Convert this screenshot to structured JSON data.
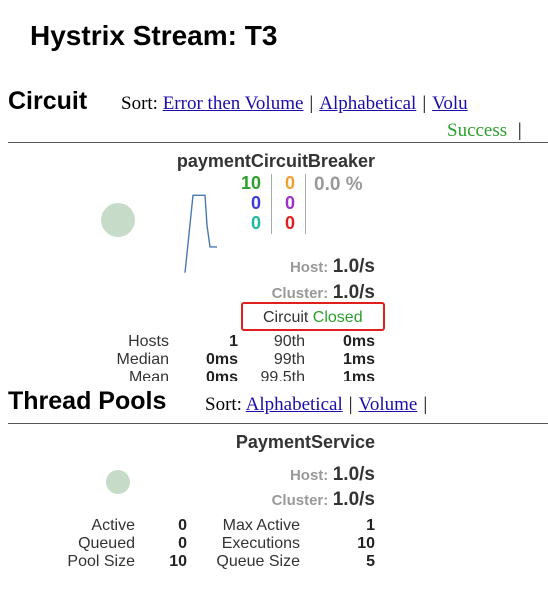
{
  "page": {
    "title": "Hystrix Stream: T3"
  },
  "circuit_section": {
    "title": "Circuit",
    "sort_label": "Sort:",
    "sort_links": [
      "Error then Volume",
      "Alphabetical",
      "Volu"
    ],
    "legend_success": "Success",
    "legend_sep": "|",
    "card": {
      "name": "paymentCircuitBreaker",
      "counts_left": [
        "10",
        "0",
        "0"
      ],
      "counts_mid": [
        "0",
        "0",
        "0"
      ],
      "error_pct": "0.0 %",
      "host_label": "Host:",
      "host_rate": "1.0/s",
      "cluster_label": "Cluster:",
      "cluster_rate": "1.0/s",
      "circuit_label": "Circuit",
      "circuit_status": "Closed",
      "stats": {
        "hosts_label": "Hosts",
        "hosts_value": "1",
        "median_label": "Median",
        "median_value": "0ms",
        "mean_label": "Mean",
        "mean_value": "0ms",
        "p90_label": "90th",
        "p90_value": "0ms",
        "p99_label": "99th",
        "p99_value": "1ms",
        "p995_label": "99.5th",
        "p995_value": "1ms"
      },
      "sparkline": [
        0.05,
        0.95,
        0.95,
        0.95,
        0.95,
        0.6,
        0.35,
        0.35
      ]
    }
  },
  "threadpool_section": {
    "title": "Thread Pools",
    "sort_label": "Sort:",
    "sort_links": [
      "Alphabetical",
      "Volume"
    ],
    "card": {
      "name": "PaymentService",
      "host_label": "Host:",
      "host_rate": "1.0/s",
      "cluster_label": "Cluster:",
      "cluster_rate": "1.0/s",
      "stats": {
        "active_label": "Active",
        "active_value": "0",
        "queued_label": "Queued",
        "queued_value": "0",
        "poolsize_label": "Pool Size",
        "poolsize_value": "10",
        "maxactive_label": "Max Active",
        "maxactive_value": "1",
        "executions_label": "Executions",
        "executions_value": "10",
        "queuesize_label": "Queue Size",
        "queuesize_value": "5"
      }
    }
  },
  "colors": {
    "success": "#2ca02c",
    "link": "#1a0dab",
    "highlight_box": "#e0201c",
    "circle": "#c7dbc9"
  }
}
